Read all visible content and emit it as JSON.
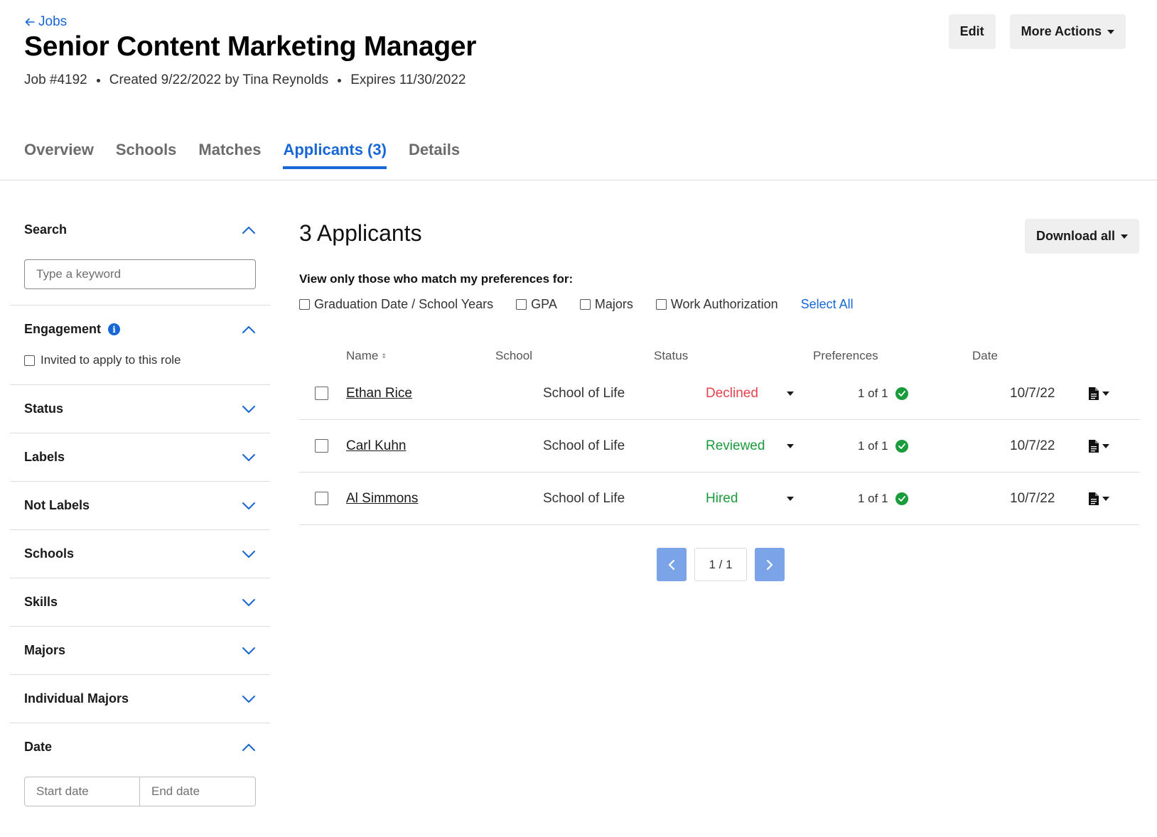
{
  "header": {
    "back_label": "Jobs",
    "title": "Senior Content Marketing Manager",
    "meta": [
      "Job #4192",
      "Created 9/22/2022 by Tina Reynolds",
      "Expires 11/30/2022"
    ]
  },
  "actions": {
    "edit_label": "Edit",
    "more_label": "More Actions"
  },
  "tabs": [
    {
      "label": "Overview",
      "active": false
    },
    {
      "label": "Schools",
      "active": false
    },
    {
      "label": "Matches",
      "active": false
    },
    {
      "label": "Applicants (3)",
      "active": true
    },
    {
      "label": "Details",
      "active": false
    }
  ],
  "sidebar": {
    "search": {
      "title": "Search",
      "placeholder": "Type a keyword"
    },
    "engagement": {
      "title": "Engagement",
      "info_icon": "i",
      "option": "Invited to apply to this role"
    },
    "collapsed": [
      "Status",
      "Labels",
      "Not Labels",
      "Schools",
      "Skills",
      "Majors",
      "Individual Majors"
    ],
    "date": {
      "title": "Date",
      "start_placeholder": "Start date",
      "end_placeholder": "End date"
    }
  },
  "main": {
    "title": "3 Applicants",
    "download_label": "Download all",
    "pref_label": "View only those who match my preferences for:",
    "pref_options": [
      "Graduation Date / School Years",
      "GPA",
      "Majors",
      "Work Authorization"
    ],
    "select_all": "Select All"
  },
  "table": {
    "headers": {
      "name": "Name",
      "school": "School",
      "status": "Status",
      "preferences": "Preferences",
      "date": "Date"
    },
    "rows": [
      {
        "name": "Ethan Rice",
        "school": "School of Life",
        "status": "Declined",
        "prefs": "1 of 1",
        "date": "10/7/22"
      },
      {
        "name": "Carl Kuhn",
        "school": "School of Life",
        "status": "Reviewed",
        "prefs": "1 of 1",
        "date": "10/7/22"
      },
      {
        "name": "Al Simmons",
        "school": "School of Life",
        "status": "Hired",
        "prefs": "1 of 1",
        "date": "10/7/22"
      }
    ]
  },
  "pagination": {
    "label": "1 / 1"
  },
  "colors": {
    "accent": "#1767d6",
    "declined": "#e8424c",
    "positive": "#1a9b3c",
    "page_button": "#7aa3e8"
  }
}
